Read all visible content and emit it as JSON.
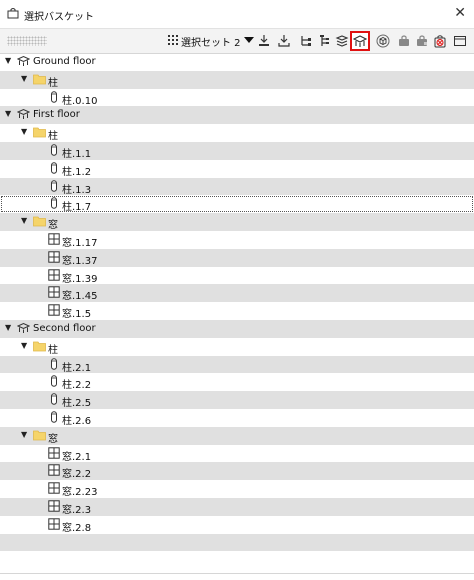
{
  "window": {
    "title": "選択バスケット",
    "bag_icon": "shopping-bag-icon",
    "close_icon": "close-icon"
  },
  "toolbar": {
    "selection_set_label": "選択セット 2",
    "buttons": [
      {
        "name": "grid-menu-icon"
      },
      {
        "name": "dropdown-arrow-icon"
      },
      {
        "name": "import-icon"
      },
      {
        "name": "export-icon"
      },
      {
        "name": "tree-structure-icon"
      },
      {
        "name": "tree-branch-icon"
      },
      {
        "name": "layers-icon"
      },
      {
        "name": "building-level-icon",
        "active": true
      },
      {
        "name": "cube-icon"
      },
      {
        "name": "basket-icon"
      },
      {
        "name": "basket-add-icon"
      },
      {
        "name": "basket-clear-icon"
      },
      {
        "name": "panel-icon"
      }
    ]
  },
  "tree": [
    {
      "type": "level",
      "label": "Ground floor"
    },
    {
      "type": "folder",
      "label": "柱"
    },
    {
      "type": "column",
      "label": "柱.0.10"
    },
    {
      "type": "level",
      "label": "First floor"
    },
    {
      "type": "folder",
      "label": "柱"
    },
    {
      "type": "column",
      "label": "柱.1.1"
    },
    {
      "type": "column",
      "label": "柱.1.2"
    },
    {
      "type": "column",
      "label": "柱.1.3"
    },
    {
      "type": "column",
      "label": "柱.1.7",
      "selected": true
    },
    {
      "type": "folder",
      "label": "窓"
    },
    {
      "type": "window",
      "label": "窓.1.17"
    },
    {
      "type": "window",
      "label": "窓.1.37"
    },
    {
      "type": "window",
      "label": "窓.1.39"
    },
    {
      "type": "window",
      "label": "窓.1.45"
    },
    {
      "type": "window",
      "label": "窓.1.5"
    },
    {
      "type": "level",
      "label": "Second floor"
    },
    {
      "type": "folder",
      "label": "柱"
    },
    {
      "type": "column",
      "label": "柱.2.1"
    },
    {
      "type": "column",
      "label": "柱.2.2"
    },
    {
      "type": "column",
      "label": "柱.2.5"
    },
    {
      "type": "column",
      "label": "柱.2.6"
    },
    {
      "type": "folder",
      "label": "窓"
    },
    {
      "type": "window",
      "label": "窓.2.1"
    },
    {
      "type": "window",
      "label": "窓.2.2"
    },
    {
      "type": "window",
      "label": "窓.2.23"
    },
    {
      "type": "window",
      "label": "窓.2.3"
    },
    {
      "type": "window",
      "label": "窓.2.8"
    },
    {
      "type": "empty",
      "label": ""
    },
    {
      "type": "empty",
      "label": ""
    }
  ],
  "colors": {
    "row_alt": "#e0e0e0",
    "active_border": "#e01010",
    "folder": "#f5d46a"
  }
}
